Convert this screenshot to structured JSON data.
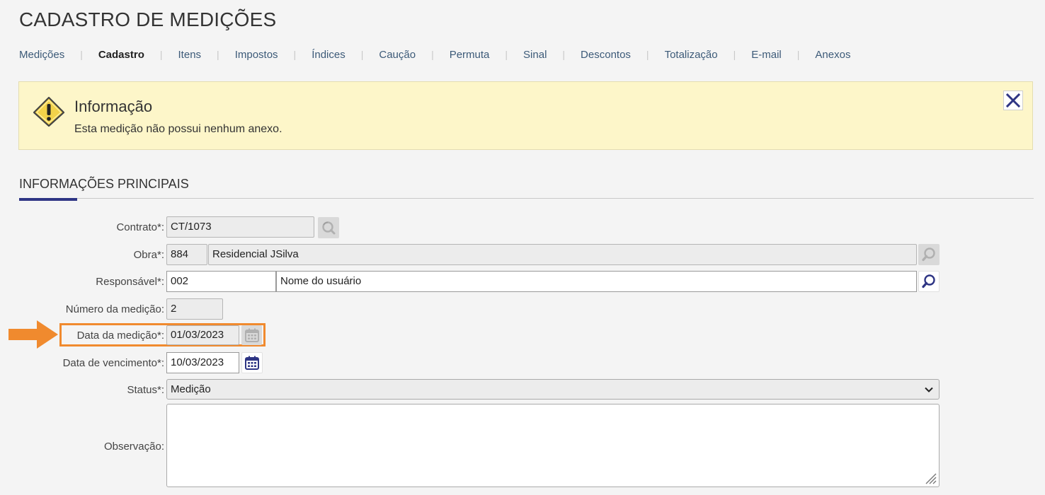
{
  "page": {
    "title": "CADASTRO DE MEDIÇÕES"
  },
  "tabs": [
    {
      "label": "Medições",
      "active": false
    },
    {
      "label": "Cadastro",
      "active": true
    },
    {
      "label": "Itens",
      "active": false
    },
    {
      "label": "Impostos",
      "active": false
    },
    {
      "label": "Índices",
      "active": false
    },
    {
      "label": "Caução",
      "active": false
    },
    {
      "label": "Permuta",
      "active": false
    },
    {
      "label": "Sinal",
      "active": false
    },
    {
      "label": "Descontos",
      "active": false
    },
    {
      "label": "Totalização",
      "active": false
    },
    {
      "label": "E-mail",
      "active": false
    },
    {
      "label": "Anexos",
      "active": false
    }
  ],
  "alert": {
    "title": "Informação",
    "message": "Esta medição não possui nenhum anexo.",
    "icon": "warning-icon",
    "close_icon": "close-icon"
  },
  "section": {
    "title": "INFORMAÇÕES PRINCIPAIS"
  },
  "form": {
    "contrato": {
      "label": "Contrato*:",
      "value": "CT/1073"
    },
    "obra": {
      "label": "Obra*:",
      "code": "884",
      "name": "Residencial JSilva"
    },
    "responsavel": {
      "label": "Responsável*:",
      "code": "002",
      "name": "Nome do usuário"
    },
    "numero": {
      "label": "Número da medição:",
      "value": "2"
    },
    "data_medicao": {
      "label": "Data da medição*:",
      "value": "01/03/2023"
    },
    "data_vencimento": {
      "label": "Data de vencimento*:",
      "value": "10/03/2023"
    },
    "status": {
      "label": "Status*:",
      "value": "Medição"
    },
    "observacao": {
      "label": "Observação:",
      "value": ""
    }
  },
  "colors": {
    "accent": "#2e3584",
    "highlight": "#f08a2e",
    "alert_bg": "#fdf6c9",
    "tab_link": "#3c5a78"
  }
}
